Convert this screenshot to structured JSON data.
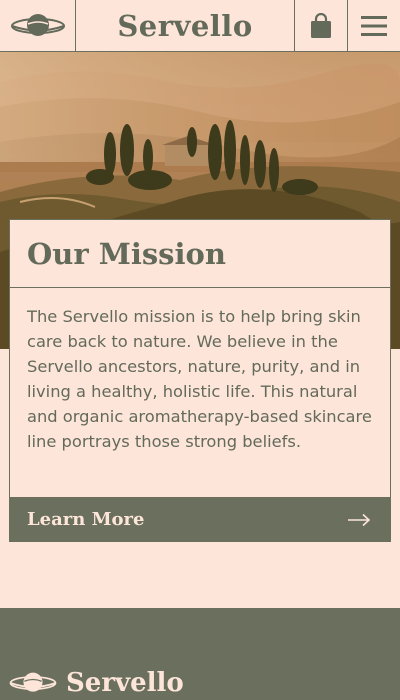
{
  "colors": {
    "background": "#fde5da",
    "accent": "#6b705e",
    "text": "#636a5a"
  },
  "header": {
    "brand": "Servello",
    "logo_icon": "planet-logo-icon",
    "cart_icon": "shopping-bag-icon",
    "menu_icon": "hamburger-menu-icon"
  },
  "hero": {
    "image": "tuscan-landscape-sunset"
  },
  "mission": {
    "title": "Our Mission",
    "body": "The Servello mission is to help bring skin care back to nature. We believe in the Servello ancestors, nature, purity, and in living a healthy, holistic life. This natural and organic aromatherapy-based skincare line portrays those strong beliefs.",
    "button_label": "Learn More",
    "button_icon": "arrow-right-icon"
  },
  "footer": {
    "brand": "Servello",
    "logo_icon": "planet-logo-icon"
  }
}
